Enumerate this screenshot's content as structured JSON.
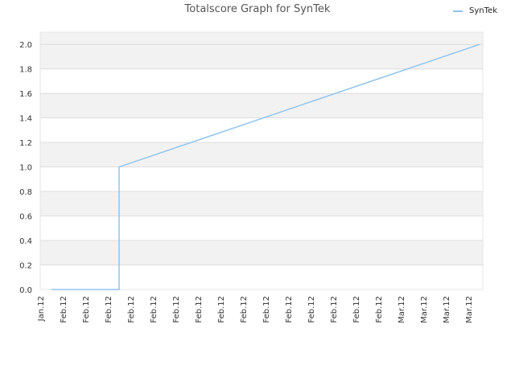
{
  "chart_data": {
    "type": "line",
    "title": "Totalscore Graph for SynTek",
    "xlabel": "",
    "ylabel": "",
    "ylim": [
      0,
      2.1
    ],
    "yticks": [
      0.0,
      0.2,
      0.4,
      0.6,
      0.8,
      1.0,
      1.2,
      1.4,
      1.6,
      1.8,
      2.0
    ],
    "ytick_labels": [
      "0.0",
      "0.2",
      "0.4",
      "0.6",
      "0.8",
      "1.0",
      "1.2",
      "1.4",
      "1.6",
      "1.8",
      "2.0"
    ],
    "xtick_labels": [
      "Jan.12",
      "Feb.12",
      "Feb.12",
      "Feb.12",
      "Feb.12",
      "Feb.12",
      "Feb.12",
      "Feb.12",
      "Feb.12",
      "Feb.12",
      "Feb.12",
      "Feb.12",
      "Feb.12",
      "Feb.12",
      "Feb.12",
      "Feb.12",
      "Mar.12",
      "Mar.12",
      "Mar.12",
      "Mar.12"
    ],
    "grid": "horizontal bands",
    "legend": "top-right",
    "colors": {
      "series": "#90c4f0",
      "band": "#f2f2f2",
      "gridline": "#dddddd"
    },
    "series": [
      {
        "name": "SynTek",
        "points": [
          {
            "x": 0.5,
            "y": 0.0
          },
          {
            "x": 3.5,
            "y": 0.0
          },
          {
            "x": 3.5,
            "y": 1.0
          },
          {
            "x": 19.5,
            "y": 2.0
          }
        ]
      }
    ]
  }
}
